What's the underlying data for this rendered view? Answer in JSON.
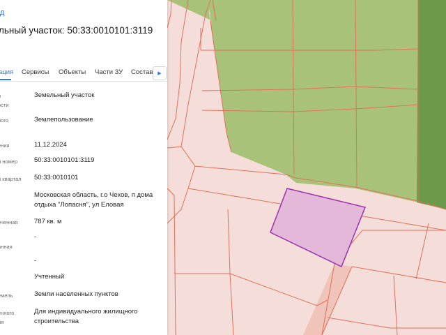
{
  "panel": {
    "back_link": "д",
    "title": "льный участок: 50:33:0010101:3119",
    "tabs": [
      {
        "label": "ация"
      },
      {
        "label": "Сервисы"
      },
      {
        "label": "Объекты"
      },
      {
        "label": "Части ЗУ"
      },
      {
        "label": "Состав"
      }
    ],
    "tab_next_icon": "chevron-right-icon",
    "rows": [
      {
        "label1": "п",
        "label2": "ости",
        "value": "Земельный участок"
      },
      {
        "label1": "ного",
        "label2": "",
        "value": "Землепользование"
      },
      {
        "label1": "ения",
        "label2": "",
        "value": "11.12.2024"
      },
      {
        "label1": "й номер",
        "label2": "",
        "value": "50:33:0010101:3119"
      },
      {
        "label1": "й квартал",
        "label2": "",
        "value": "50:33:0010101"
      },
      {
        "label1": "",
        "label2": "",
        "value": "Московская область, г.о Чехов, п дома",
        "value2": "отдыха \"Лопасня\", ул Еловая"
      },
      {
        "label1": "оченная",
        "label2": "",
        "value": "787 кв. м"
      },
      {
        "label1": "анная",
        "label2": "",
        "value": "-"
      },
      {
        "label1": "",
        "label2": "",
        "value": "-"
      },
      {
        "label1": "",
        "label2": "",
        "value": "Учтенный"
      },
      {
        "label1": "емель",
        "label2": "",
        "value": "Земли населенных пунктов"
      },
      {
        "label1": "енного",
        "label2": "ия",
        "value": "Для индивидуального жилищного",
        "value2": "строительства"
      }
    ]
  },
  "map": {
    "colors": {
      "background": "#f5ded9",
      "forest": "#a9c27a",
      "forest_dark": "#6a9a4a",
      "boundary": "#e0705a",
      "selected_fill": "#e4b8d8",
      "selected_stroke": "#9b2fae",
      "road": "#f0c4b8"
    }
  }
}
